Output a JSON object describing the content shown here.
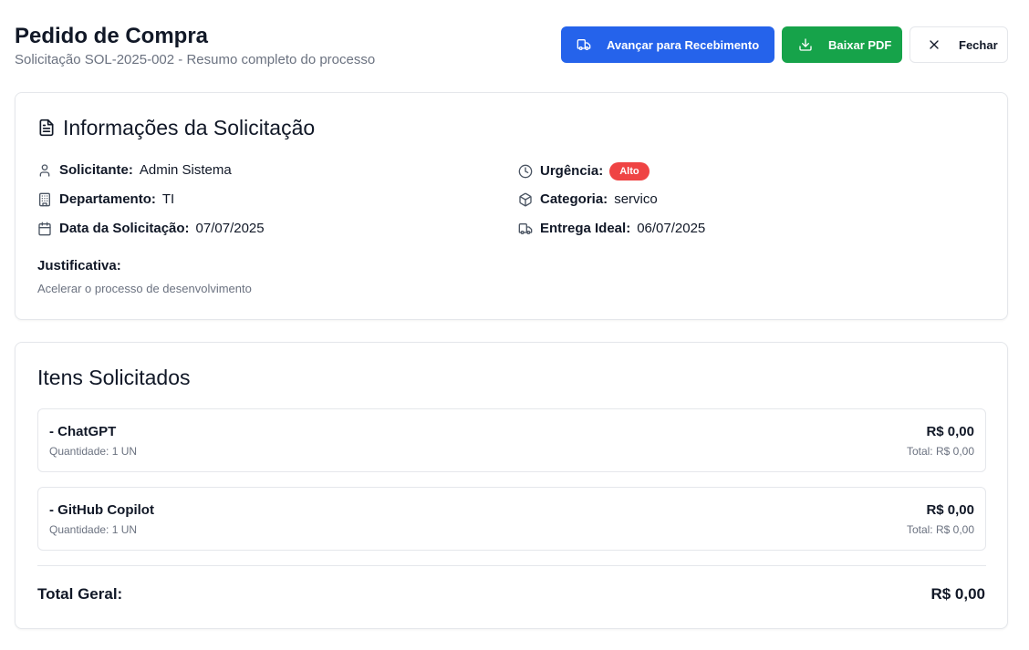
{
  "header": {
    "title": "Pedido de Compra",
    "subtitle": "Solicitação SOL-2025-002 - Resumo completo do processo"
  },
  "actions": {
    "advance_label": "Avançar para Recebimento",
    "download_label": "Baixar PDF",
    "close_label": "Fechar"
  },
  "info": {
    "title": "Informações da Solicitação",
    "requester": {
      "label": "Solicitante:",
      "value": "Admin Sistema",
      "icon": "user-icon"
    },
    "department": {
      "label": "Departamento:",
      "value": "TI",
      "icon": "building-icon"
    },
    "request_date": {
      "label": "Data da Solicitação:",
      "value": "07/07/2025",
      "icon": "calendar-icon"
    },
    "urgency": {
      "label": "Urgência:",
      "value": "Alto",
      "icon": "clock-icon",
      "color": "#ef4444"
    },
    "category": {
      "label": "Categoria:",
      "value": "servico",
      "icon": "package-icon"
    },
    "ideal_delivery": {
      "label": "Entrega Ideal:",
      "value": "06/07/2025",
      "icon": "truck-icon"
    },
    "justification_label": "Justificativa:",
    "justification_text": "Acelerar o processo de desenvolvimento"
  },
  "items": {
    "title": "Itens Solicitados",
    "list": [
      {
        "name": "- ChatGPT",
        "quantity": "Quantidade: 1 UN",
        "price": "R$ 0,00",
        "total": "Total: R$ 0,00"
      },
      {
        "name": "- GitHub Copilot",
        "quantity": "Quantidade: 1 UN",
        "price": "R$ 0,00",
        "total": "Total: R$ 0,00"
      }
    ],
    "grand_total_label": "Total Geral:",
    "grand_total_value": "R$ 0,00"
  },
  "colors": {
    "primary": "#2563eb",
    "success": "#16a34a",
    "danger": "#ef4444"
  }
}
